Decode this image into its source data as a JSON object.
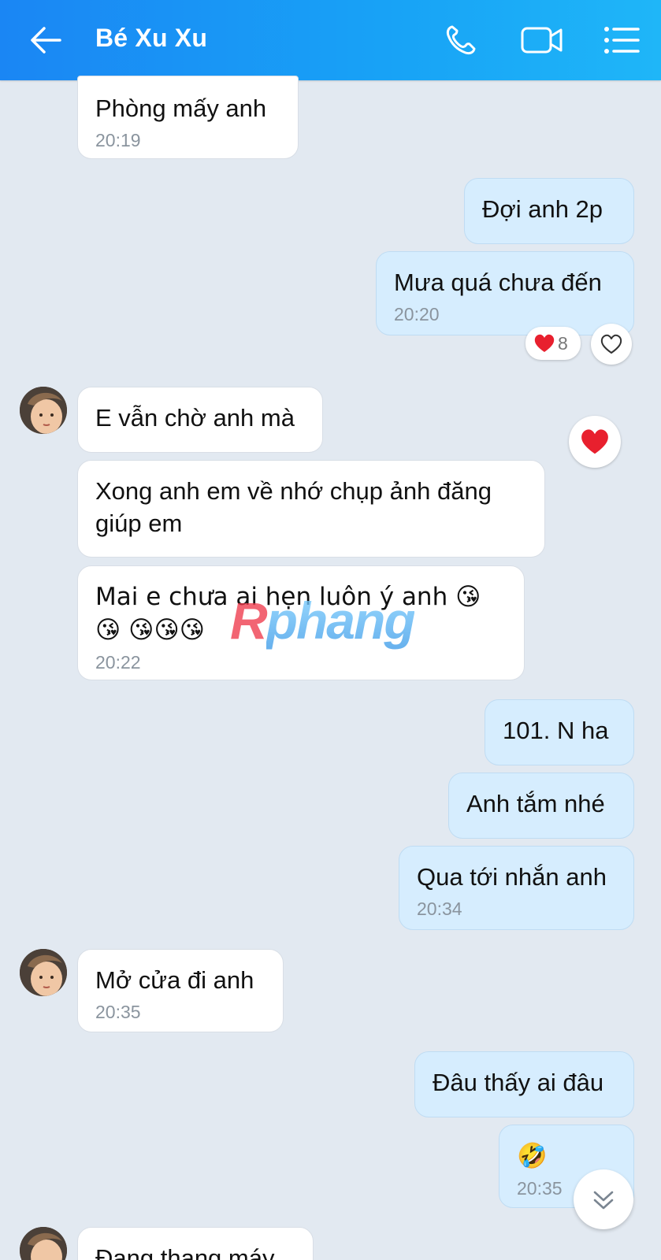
{
  "header": {
    "title": "Bé Xu Xu",
    "back_icon": "arrow-left-icon",
    "call_icon": "phone-icon",
    "video_icon": "video-camera-icon",
    "menu_icon": "list-menu-icon"
  },
  "messages": [
    {
      "side": "in",
      "text": "Phòng mấy anh",
      "time": "20:19"
    },
    {
      "side": "out",
      "text": "Đợi anh 2p",
      "time": ""
    },
    {
      "side": "out",
      "text": "Mưa quá chưa đến",
      "time": "20:20",
      "reaction": {
        "icon": "heart-icon",
        "count": "8"
      }
    },
    {
      "side": "in",
      "text": "E vẫn chờ anh mà",
      "time": ""
    },
    {
      "side": "in",
      "text": "Xong anh em về nhớ chụp ảnh đăng giúp em",
      "time": ""
    },
    {
      "side": "in",
      "text": "Mai e chưa ai hẹn luôn ý anh 😘😘 😘😘😘",
      "time": "20:22"
    },
    {
      "side": "out",
      "text": "101. N ha",
      "time": ""
    },
    {
      "side": "out",
      "text": "Anh tắm nhé",
      "time": ""
    },
    {
      "side": "out",
      "text": "Qua tới nhắn anh",
      "time": "20:34"
    },
    {
      "side": "in",
      "text": "Mở cửa đi anh",
      "time": "20:35"
    },
    {
      "side": "out",
      "text": "Đâu thấy ai đâu",
      "time": ""
    },
    {
      "side": "out",
      "text": "🤣",
      "time": "20:35"
    },
    {
      "side": "in",
      "text": "Đang thang máy",
      "time": ""
    }
  ],
  "watermark": {
    "first": "R",
    "rest": "phang"
  },
  "scroll_icon": "double-chevron-down-icon",
  "colors": {
    "header": "#1a86f4",
    "incoming": "#ffffff",
    "outgoing": "#d6edfe",
    "heart": "#e8202e"
  }
}
